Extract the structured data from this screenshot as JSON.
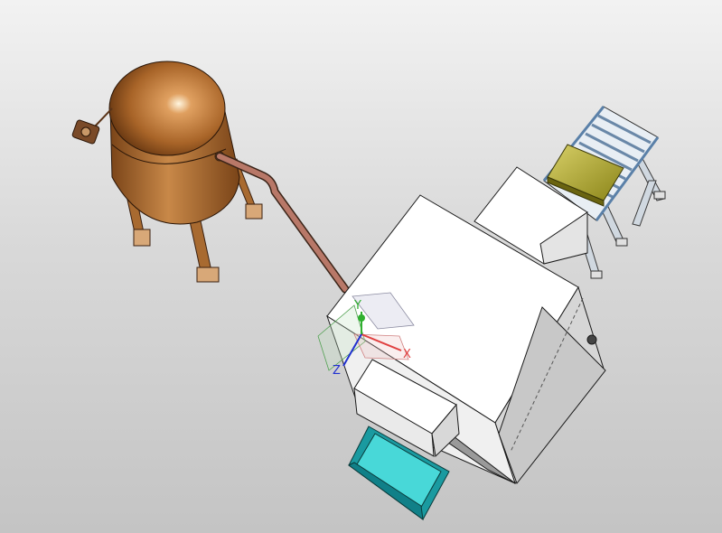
{
  "viewport": {
    "background_top": "#f2f2f2",
    "background_bottom": "#c4c4c4"
  },
  "triad": {
    "x_label": "X",
    "y_label": "Y",
    "z_label": "Z",
    "x_color": "#e04040",
    "y_color": "#30b030",
    "z_color": "#2030d0"
  },
  "colors": {
    "tank": "#b8743a",
    "pipe": "#a86850",
    "machine": "#ffffff",
    "bin": "#30c8c8",
    "tray": "#a8a030",
    "conveyor": "#7aa0c8"
  },
  "icons": [
    "compressor-tank-icon",
    "gauge-icon",
    "feeder-conveyor-icon",
    "coordinate-triad-icon"
  ]
}
